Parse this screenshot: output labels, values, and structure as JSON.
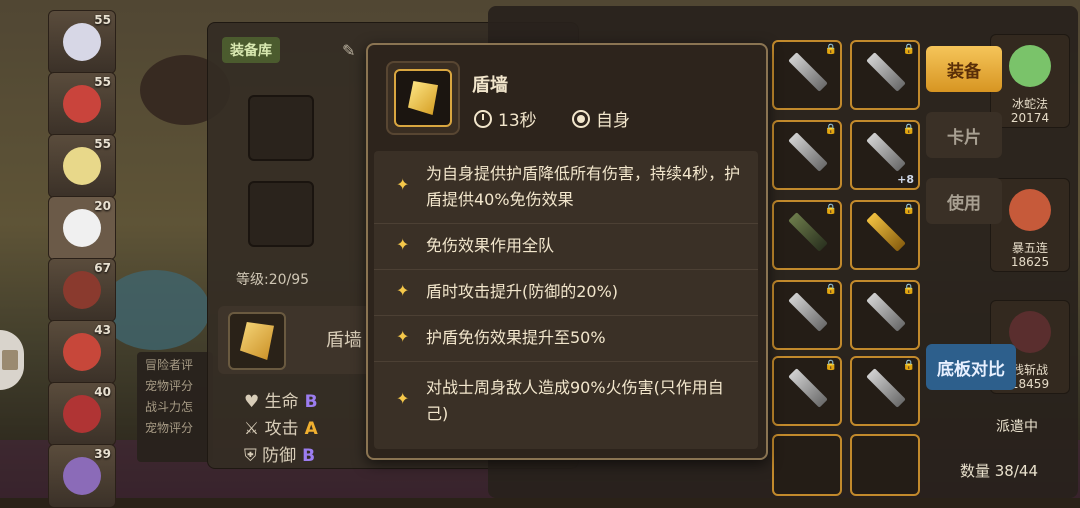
{
  "left_heroes": [
    {
      "level": "55",
      "color": "#d7d7e6"
    },
    {
      "level": "55",
      "color": "#c9443c"
    },
    {
      "level": "55",
      "color": "#e8d88a"
    },
    {
      "level": "20",
      "color": "#f0f0f0"
    },
    {
      "level": "67",
      "color": "#8a3a2e"
    },
    {
      "level": "43",
      "color": "#c7473a"
    },
    {
      "level": "40",
      "color": "#b03434"
    },
    {
      "level": "39",
      "color": "#8b6bb8"
    }
  ],
  "equipment": {
    "tag": "装备库",
    "level_text": "等级:20/95",
    "skill_name": "盾墙",
    "stats": [
      {
        "label": "生命",
        "grade": "B"
      },
      {
        "label": "攻击",
        "grade": "A"
      },
      {
        "label": "防御",
        "grade": "B"
      }
    ]
  },
  "eval_lines": [
    "冒险者评",
    "宠物评分",
    "战斗力怎",
    "宠物评分"
  ],
  "right_heroes": [
    {
      "name": "冰蛇法",
      "power": "20174",
      "color": "#7ac36a"
    },
    {
      "name": "暴五连",
      "power": "18625",
      "color": "#c65a3a"
    },
    {
      "name": "残斩战",
      "power": "18459",
      "color": "#5a2e2e"
    }
  ],
  "buttons": {
    "equip": "装备",
    "card": "卡片",
    "use": "使用",
    "compare": "底板对比"
  },
  "dispatch_label": "派遣中",
  "count_label": "数量 38/44",
  "tooltip": {
    "title": "盾墙",
    "cooldown": "13秒",
    "target": "自身",
    "effects": [
      "为自身提供护盾降低所有伤害，持续4秒，护盾提供40%免伤效果",
      "免伤效果作用全队",
      "盾时攻击提升(防御的20%)",
      "护盾免伤效果提升至50%",
      "对战士周身敌人造成90%火伤害(只作用自己)"
    ],
    "colors": {
      "accent": "#f5c84a",
      "border": "#8a7452"
    }
  }
}
